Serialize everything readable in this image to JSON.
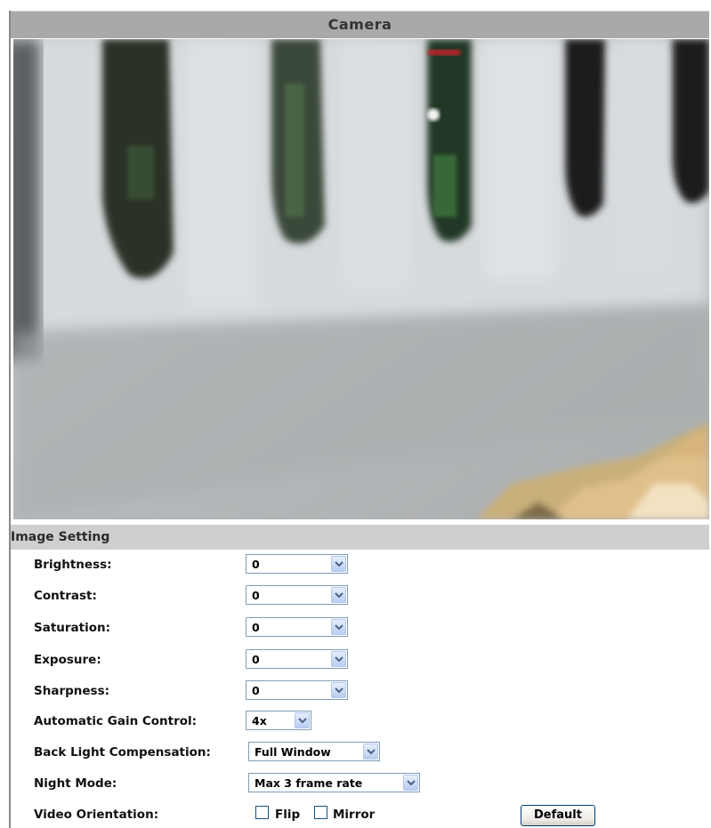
{
  "camera": {
    "title": "Camera"
  },
  "image_setting": {
    "title": "Image Setting",
    "fields": [
      {
        "label": "Brightness:",
        "value": "0"
      },
      {
        "label": "Contrast:",
        "value": "0"
      },
      {
        "label": "Saturation:",
        "value": "0"
      },
      {
        "label": "Exposure:",
        "value": "0"
      },
      {
        "label": "Sharpness:",
        "value": "0"
      },
      {
        "label": "Automatic Gain Control:",
        "value": "4x"
      },
      {
        "label": "Back Light Compensation:",
        "value": "Full Window"
      },
      {
        "label": "Night Mode:",
        "value": "Max 3 frame rate"
      }
    ],
    "orientation": {
      "label": "Video Orientation:",
      "flip_label": "Flip",
      "flip_checked": false,
      "mirror_label": "Mirror",
      "mirror_checked": false
    },
    "default_button": "Default"
  },
  "icons": {
    "dropdown": "chevron-down-icon"
  },
  "colors": {
    "header_bg": "#a9a9a9",
    "section_bg": "#cfcfcf",
    "select_border": "#7f9db9",
    "arrow_bg": "#b9cdf3"
  }
}
